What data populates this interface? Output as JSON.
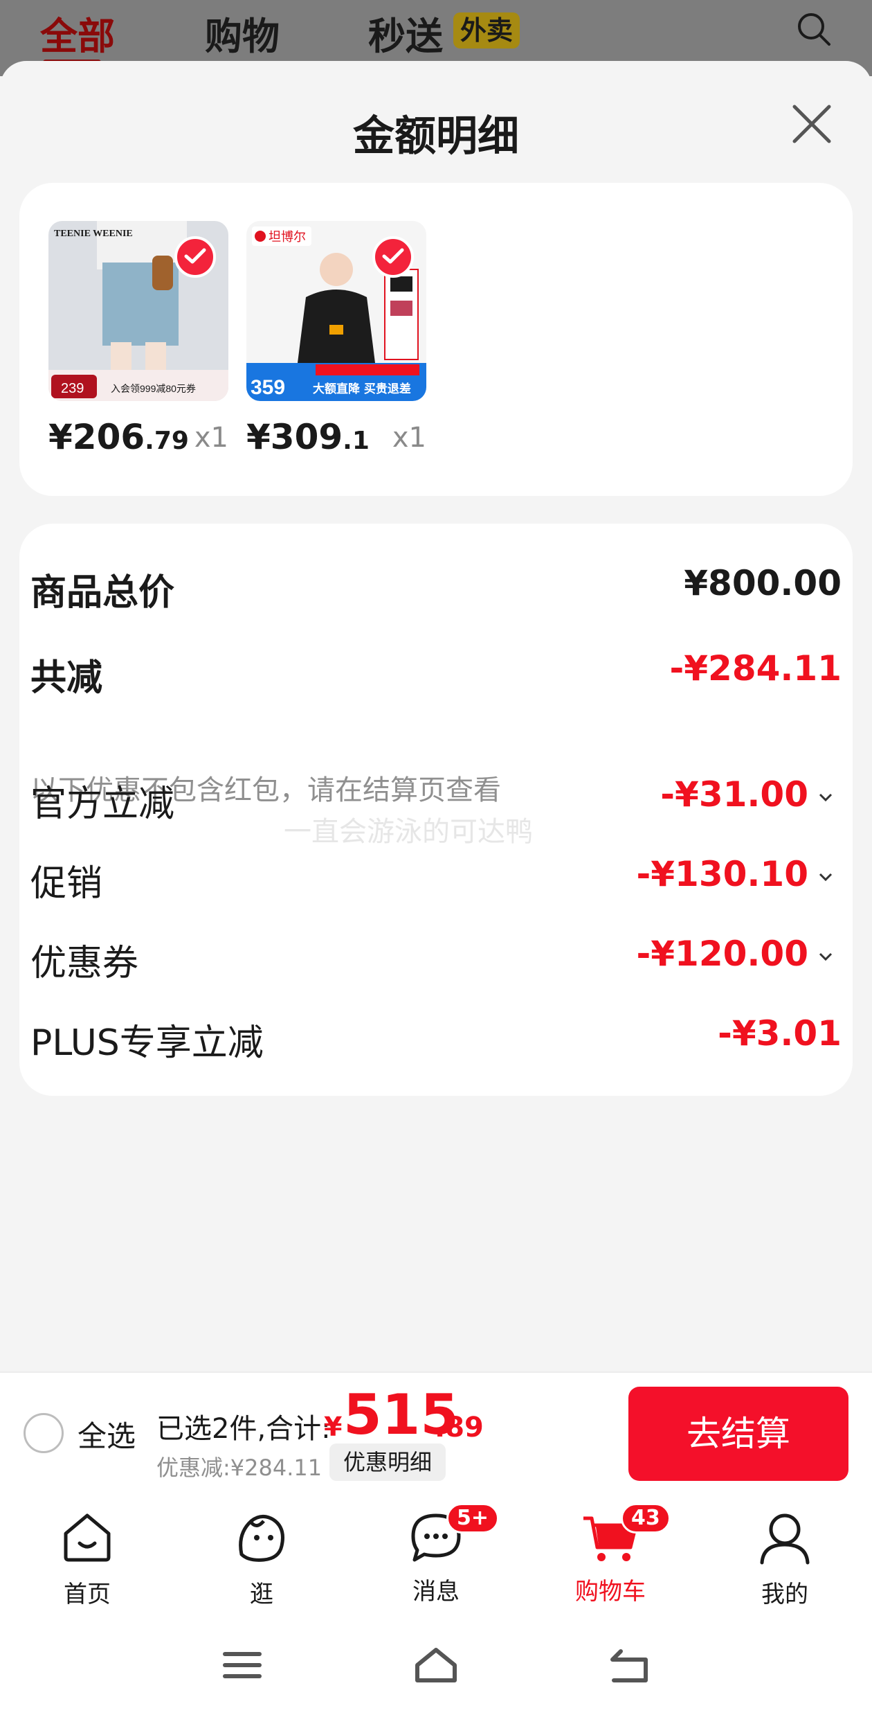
{
  "top_tabs": {
    "all": "全部",
    "shopping": "购物",
    "flash": "秒送",
    "takeout_badge": "外卖"
  },
  "sheet": {
    "title": "金额明细"
  },
  "products": [
    {
      "price_int": "¥206",
      "price_dec": ".79",
      "qty": "x1",
      "img_brand": "TEENIE WEENIE",
      "img_promo": "239",
      "img_promo_text": "入会领999减80元券"
    },
    {
      "price_int": "¥309",
      "price_dec": ".1",
      "qty": "x1",
      "img_brand": "坦博尔",
      "img_promo": "359",
      "img_promo_text": "大额直降 买贵退差"
    }
  ],
  "summary": {
    "total_label": "商品总价",
    "total_value": "¥800.00",
    "reduce_label": "共减",
    "reduce_value": "-¥284.11",
    "note": "以下优惠不包含红包，请在结算页查看",
    "items": [
      {
        "label": "官方立减",
        "value": "-¥31.00"
      },
      {
        "label": "促销",
        "value": "-¥130.10"
      },
      {
        "label": "优惠券",
        "value": "-¥120.00"
      },
      {
        "label": "PLUS专享立减",
        "value": "-¥3.01"
      }
    ],
    "watermark": "一直会游泳的可达鸭"
  },
  "checkout": {
    "select_all": "全选",
    "selected_text": "已选2件,合计:",
    "total_yen": "¥",
    "total_int": "515",
    "total_dec": ".89",
    "discount_text": "优惠减:¥284.11",
    "detail_button": "优惠明细",
    "checkout_button": "去结算"
  },
  "bottom_nav": {
    "home": "首页",
    "browse": "逛",
    "messages": "消息",
    "messages_badge": "5+",
    "cart": "购物车",
    "cart_badge": "43",
    "me": "我的"
  },
  "colors": {
    "accent": "#f0111f",
    "checkout_button": "#f4102a"
  }
}
